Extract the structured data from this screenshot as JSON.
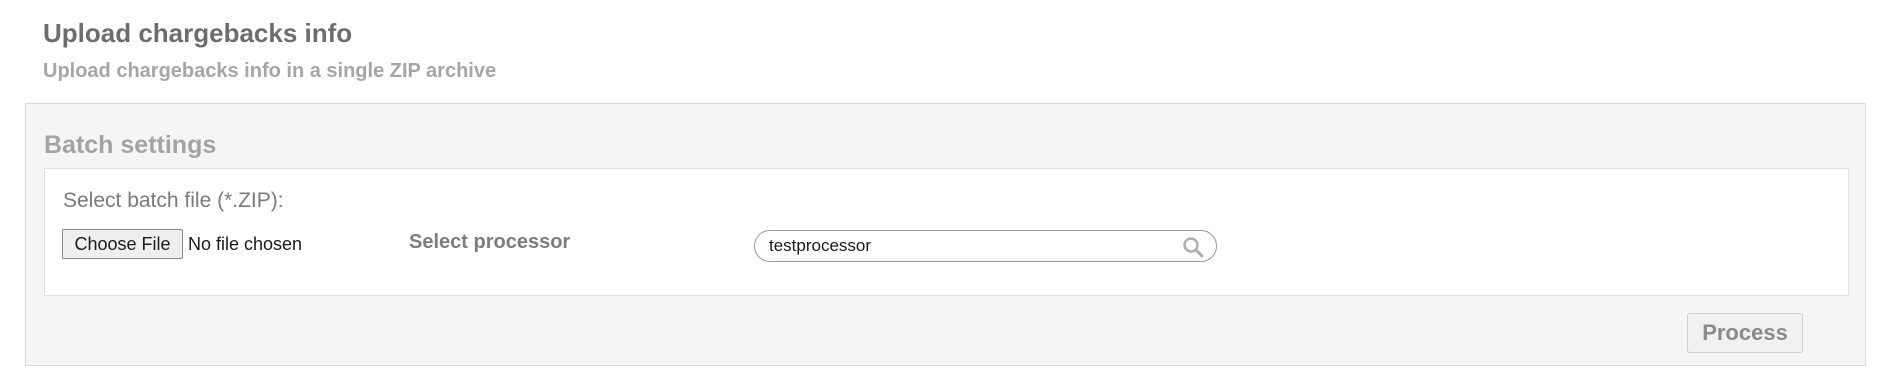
{
  "header": {
    "title": "Upload chargebacks info",
    "subtitle": "Upload chargebacks info in a single ZIP archive"
  },
  "batch_settings": {
    "title": "Batch settings",
    "file_label": "Select batch file (*.ZIP):",
    "choose_file_label": "Choose File",
    "no_file_text": "No file chosen",
    "processor_label": "Select processor",
    "processor_value": "testprocessor",
    "search_icon": "search-icon",
    "process_label": "Process"
  }
}
